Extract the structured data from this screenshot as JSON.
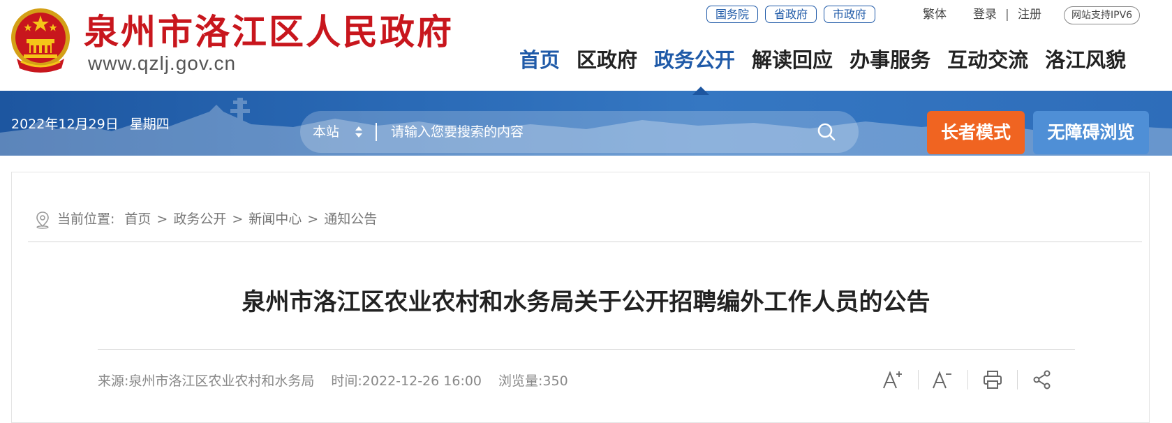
{
  "header": {
    "site_title": "泉州市洛江区人民政府",
    "site_domain": "www.qzlj.gov.cn",
    "gov_links": [
      "国务院",
      "省政府",
      "市政府"
    ],
    "traditional": "繁体",
    "login": "登录",
    "separator": "|",
    "register": "注册",
    "ipv6": "网站支持IPV6",
    "nav": [
      "首页",
      "区政府",
      "政务公开",
      "解读回应",
      "办事服务",
      "互动交流",
      "洛江风貌"
    ],
    "active_nav": "政务公开"
  },
  "banner": {
    "date": "2022年12月29日",
    "weekday": "星期四",
    "search_scope": "本站",
    "search_placeholder": "请输入您要搜索的内容",
    "elder_mode": "长者模式",
    "accessible": "无障碍浏览"
  },
  "breadcrumb": {
    "label": "当前位置:",
    "items": [
      "首页",
      "政务公开",
      "新闻中心",
      "通知公告"
    ],
    "sep": ">"
  },
  "article": {
    "title": "泉州市洛江区农业农村和水务局关于公开招聘编外工作人员的公告",
    "source": "来源:泉州市洛江区农业农村和水务局",
    "time": "时间:2022-12-26 16:00",
    "views": "浏览量:350"
  },
  "colors": {
    "brand_red": "#c8161d",
    "brand_blue": "#1f5aa8",
    "elder_orange": "#f06421",
    "access_blue": "#4f8fd6"
  },
  "icons": [
    "national-emblem-icon",
    "search-icon",
    "location-icon",
    "font-increase-icon",
    "font-decrease-icon",
    "print-icon",
    "share-icon"
  ]
}
